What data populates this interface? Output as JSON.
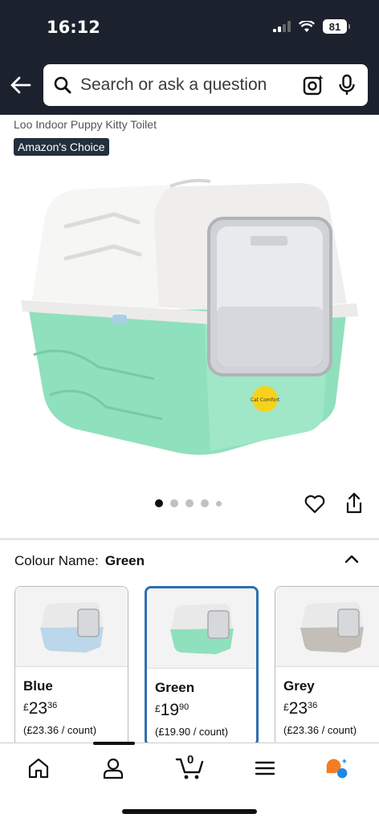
{
  "status": {
    "time": "16:12",
    "battery": "81"
  },
  "search": {
    "placeholder": "Search or ask a question"
  },
  "product": {
    "title_fragment": "Loo Indoor Puppy Kitty Toilet",
    "badge": "Amazon's Choice",
    "image_sticker_text": "Cat Comfort"
  },
  "gallery": {
    "total_images": 5,
    "current_index": 1
  },
  "variation": {
    "label": "Colour Name:",
    "selected_value": "Green",
    "options": [
      {
        "name": "Blue",
        "currency": "£",
        "price_whole": "23",
        "price_fraction": "36",
        "unit_price": "(£23.36 / count)",
        "color": "#bcd6ea"
      },
      {
        "name": "Green",
        "currency": "£",
        "price_whole": "19",
        "price_fraction": "90",
        "unit_price": "(£19.90 / count)",
        "color": "#8fe0bc"
      },
      {
        "name": "Grey",
        "currency": "£",
        "price_whole": "23",
        "price_fraction": "36",
        "unit_price": "(£23.36 / count)",
        "color": "#c3bfb8"
      }
    ]
  },
  "bottom_nav": {
    "cart_count": "0",
    "items": [
      "home-icon",
      "account-icon",
      "cart-icon",
      "menu-icon",
      "rufus-icon"
    ]
  },
  "colors": {
    "header_bg": "#1b222d",
    "selected_border": "#2c6fb1",
    "litter_green": "#8fe0bc"
  }
}
